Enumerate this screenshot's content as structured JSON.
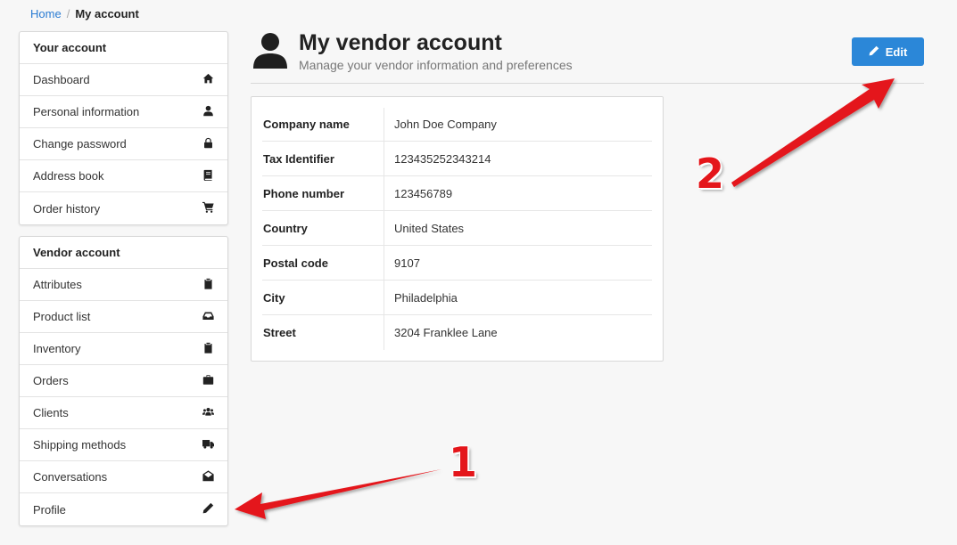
{
  "breadcrumb": {
    "home": "Home",
    "separator": "/",
    "current": "My account"
  },
  "your_account": {
    "header": "Your account",
    "items": [
      {
        "label": "Dashboard",
        "icon": "home-icon"
      },
      {
        "label": "Personal information",
        "icon": "user-icon"
      },
      {
        "label": "Change password",
        "icon": "lock-icon"
      },
      {
        "label": "Address book",
        "icon": "book-icon"
      },
      {
        "label": "Order history",
        "icon": "cart-icon"
      }
    ]
  },
  "vendor_account": {
    "header": "Vendor account",
    "items": [
      {
        "label": "Attributes",
        "icon": "clipboard-icon"
      },
      {
        "label": "Product list",
        "icon": "inbox-icon"
      },
      {
        "label": "Inventory",
        "icon": "clipboard-icon"
      },
      {
        "label": "Orders",
        "icon": "briefcase-icon"
      },
      {
        "label": "Clients",
        "icon": "users-icon"
      },
      {
        "label": "Shipping methods",
        "icon": "truck-icon"
      },
      {
        "label": "Conversations",
        "icon": "envelope-open-icon"
      },
      {
        "label": "Profile",
        "icon": "pencil-icon"
      }
    ]
  },
  "header": {
    "title": "My vendor account",
    "subtitle": "Manage your vendor information and preferences",
    "edit_label": "Edit"
  },
  "vendor_info": [
    {
      "label": "Company name",
      "value": "John Doe Company"
    },
    {
      "label": "Tax Identifier",
      "value": "123435252343214"
    },
    {
      "label": "Phone number",
      "value": "123456789"
    },
    {
      "label": "Country",
      "value": "United States"
    },
    {
      "label": "Postal code",
      "value": "9107"
    },
    {
      "label": "City",
      "value": "Philadelphia"
    },
    {
      "label": "Street",
      "value": "3204 Franklee Lane"
    }
  ],
  "annotations": {
    "one": "1",
    "two": "2",
    "color": "#e4161b"
  },
  "colors": {
    "accent": "#2b87d8",
    "link": "#2b7cd3"
  }
}
